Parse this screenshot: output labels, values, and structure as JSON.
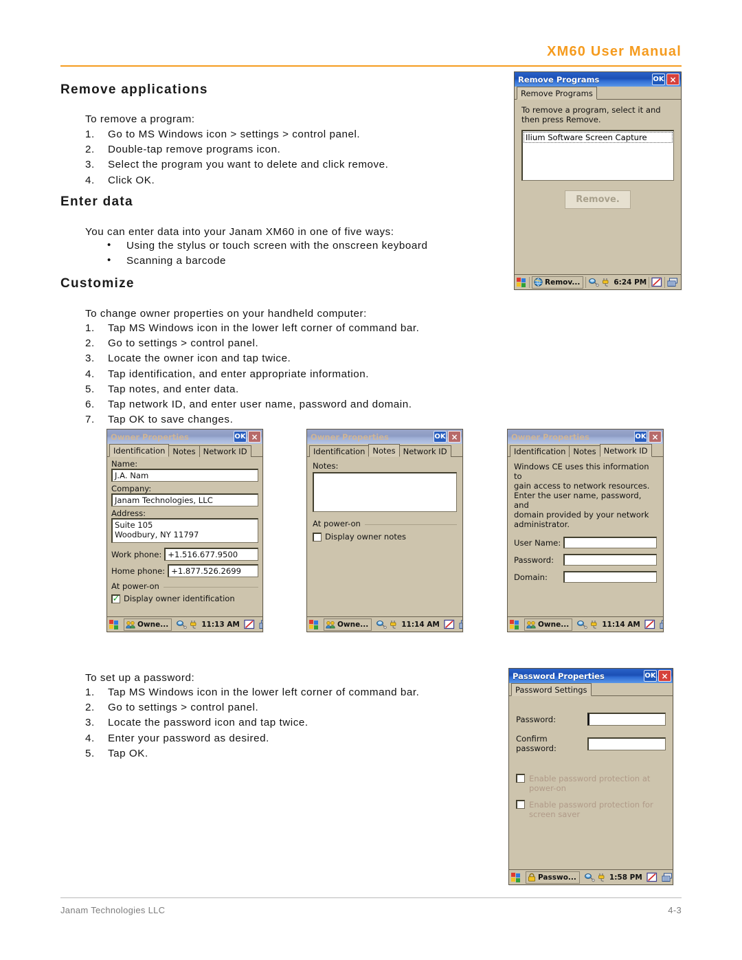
{
  "header": {
    "title": "XM60 User Manual",
    "accent": "#F59B1E"
  },
  "footer": {
    "left": "Janam Technologies LLC",
    "right": "4-3"
  },
  "sections": {
    "remove_applications": {
      "heading": "Remove applications",
      "intro": "To remove a program:",
      "steps": [
        "Go to MS Windows icon > settings > control panel.",
        "Double-tap remove programs icon.",
        "Select the program you want to delete and click remove.",
        "Click OK."
      ]
    },
    "enter_data": {
      "heading": "Enter data",
      "intro": "You can enter data into your Janam XM60 in one of five ways:",
      "bullets": [
        "Using the stylus or touch screen with the onscreen keyboard",
        "Scanning a barcode"
      ]
    },
    "customize": {
      "heading": "Customize",
      "intro": "To change owner properties on your handheld computer:",
      "steps": [
        "Tap MS Windows icon in the lower left corner of command bar.",
        "Go to settings > control panel.",
        "Locate the owner icon and tap twice.",
        "Tap identification, and enter appropriate information.",
        "Tap notes, and enter data.",
        "Tap network ID, and enter user name, password and domain.",
        "Tap OK to save changes."
      ]
    },
    "password": {
      "intro": "To set up a password:",
      "steps": [
        "Tap MS Windows icon in the lower left corner of command bar.",
        "Go to settings > control panel.",
        "Locate the password icon and tap twice.",
        "Enter your password as desired.",
        "Tap OK."
      ]
    }
  },
  "screenshots": {
    "remove_programs": {
      "title": "Remove Programs",
      "ok_label": "OK",
      "close_label": "×",
      "tabs": [
        {
          "label": "Remove Programs",
          "active": true
        }
      ],
      "instruction_line1": "To remove a program, select it and",
      "instruction_line2": "then press Remove.",
      "list_items": [
        "Ilium Software Screen Capture"
      ],
      "remove_button": "Remove.",
      "taskbar": {
        "task_label": "Remov...",
        "time": "6:24 PM"
      }
    },
    "owner_identification": {
      "title": "Owner Properties",
      "ok_label": "OK",
      "close_label": "×",
      "tabs": [
        {
          "label": "Identification",
          "active": true
        },
        {
          "label": "Notes",
          "active": false
        },
        {
          "label": "Network ID",
          "active": false
        }
      ],
      "fields": {
        "name_label": "Name:",
        "name_value": "J.A. Nam",
        "company_label": "Company:",
        "company_value": "Janam Technologies, LLC",
        "address_label": "Address:",
        "address_line1": "Suite 105",
        "address_line2": "Woodbury, NY 11797",
        "work_phone_label": "Work phone:",
        "work_phone_value": "+1.516.677.9500",
        "home_phone_label": "Home phone:",
        "home_phone_value": "+1.877.526.2699"
      },
      "group_label": "At power-on",
      "checkbox_label": "Display owner identification",
      "checkbox_checked": true,
      "taskbar": {
        "task_label": "Owne...",
        "time": "11:13 AM"
      }
    },
    "owner_notes": {
      "title": "Owner Properties",
      "ok_label": "OK",
      "close_label": "×",
      "tabs": [
        {
          "label": "Identification",
          "active": false
        },
        {
          "label": "Notes",
          "active": true
        },
        {
          "label": "Network ID",
          "active": false
        }
      ],
      "notes_label": "Notes:",
      "notes_value": "",
      "group_label": "At power-on",
      "checkbox_label": "Display owner notes",
      "checkbox_checked": false,
      "taskbar": {
        "task_label": "Owne...",
        "time": "11:14 AM"
      }
    },
    "owner_network": {
      "title": "Owner Properties",
      "ok_label": "OK",
      "close_label": "×",
      "tabs": [
        {
          "label": "Identification",
          "active": false
        },
        {
          "label": "Notes",
          "active": false
        },
        {
          "label": "Network ID",
          "active": true
        }
      ],
      "description": [
        "Windows CE uses this information to",
        "gain access to network resources.",
        "Enter the user name, password, and",
        "domain provided by your network",
        "administrator."
      ],
      "user_name_label": "User Name:",
      "user_name_value": "",
      "password_label": "Password:",
      "password_value": "",
      "domain_label": "Domain:",
      "domain_value": "",
      "taskbar": {
        "task_label": "Owne...",
        "time": "11:14 AM"
      }
    },
    "password_properties": {
      "title": "Password Properties",
      "ok_label": "OK",
      "close_label": "×",
      "tabs": [
        {
          "label": "Password Settings",
          "active": true
        }
      ],
      "password_label": "Password:",
      "password_value": "",
      "confirm_label": "Confirm password:",
      "confirm_value": "",
      "check1_line1": "Enable password protection at",
      "check1_line2": "power-on",
      "check2_line1": "Enable password protection for",
      "check2_line2": "screen saver",
      "taskbar": {
        "task_label": "Passwo...",
        "time": "1:58 PM"
      }
    }
  }
}
